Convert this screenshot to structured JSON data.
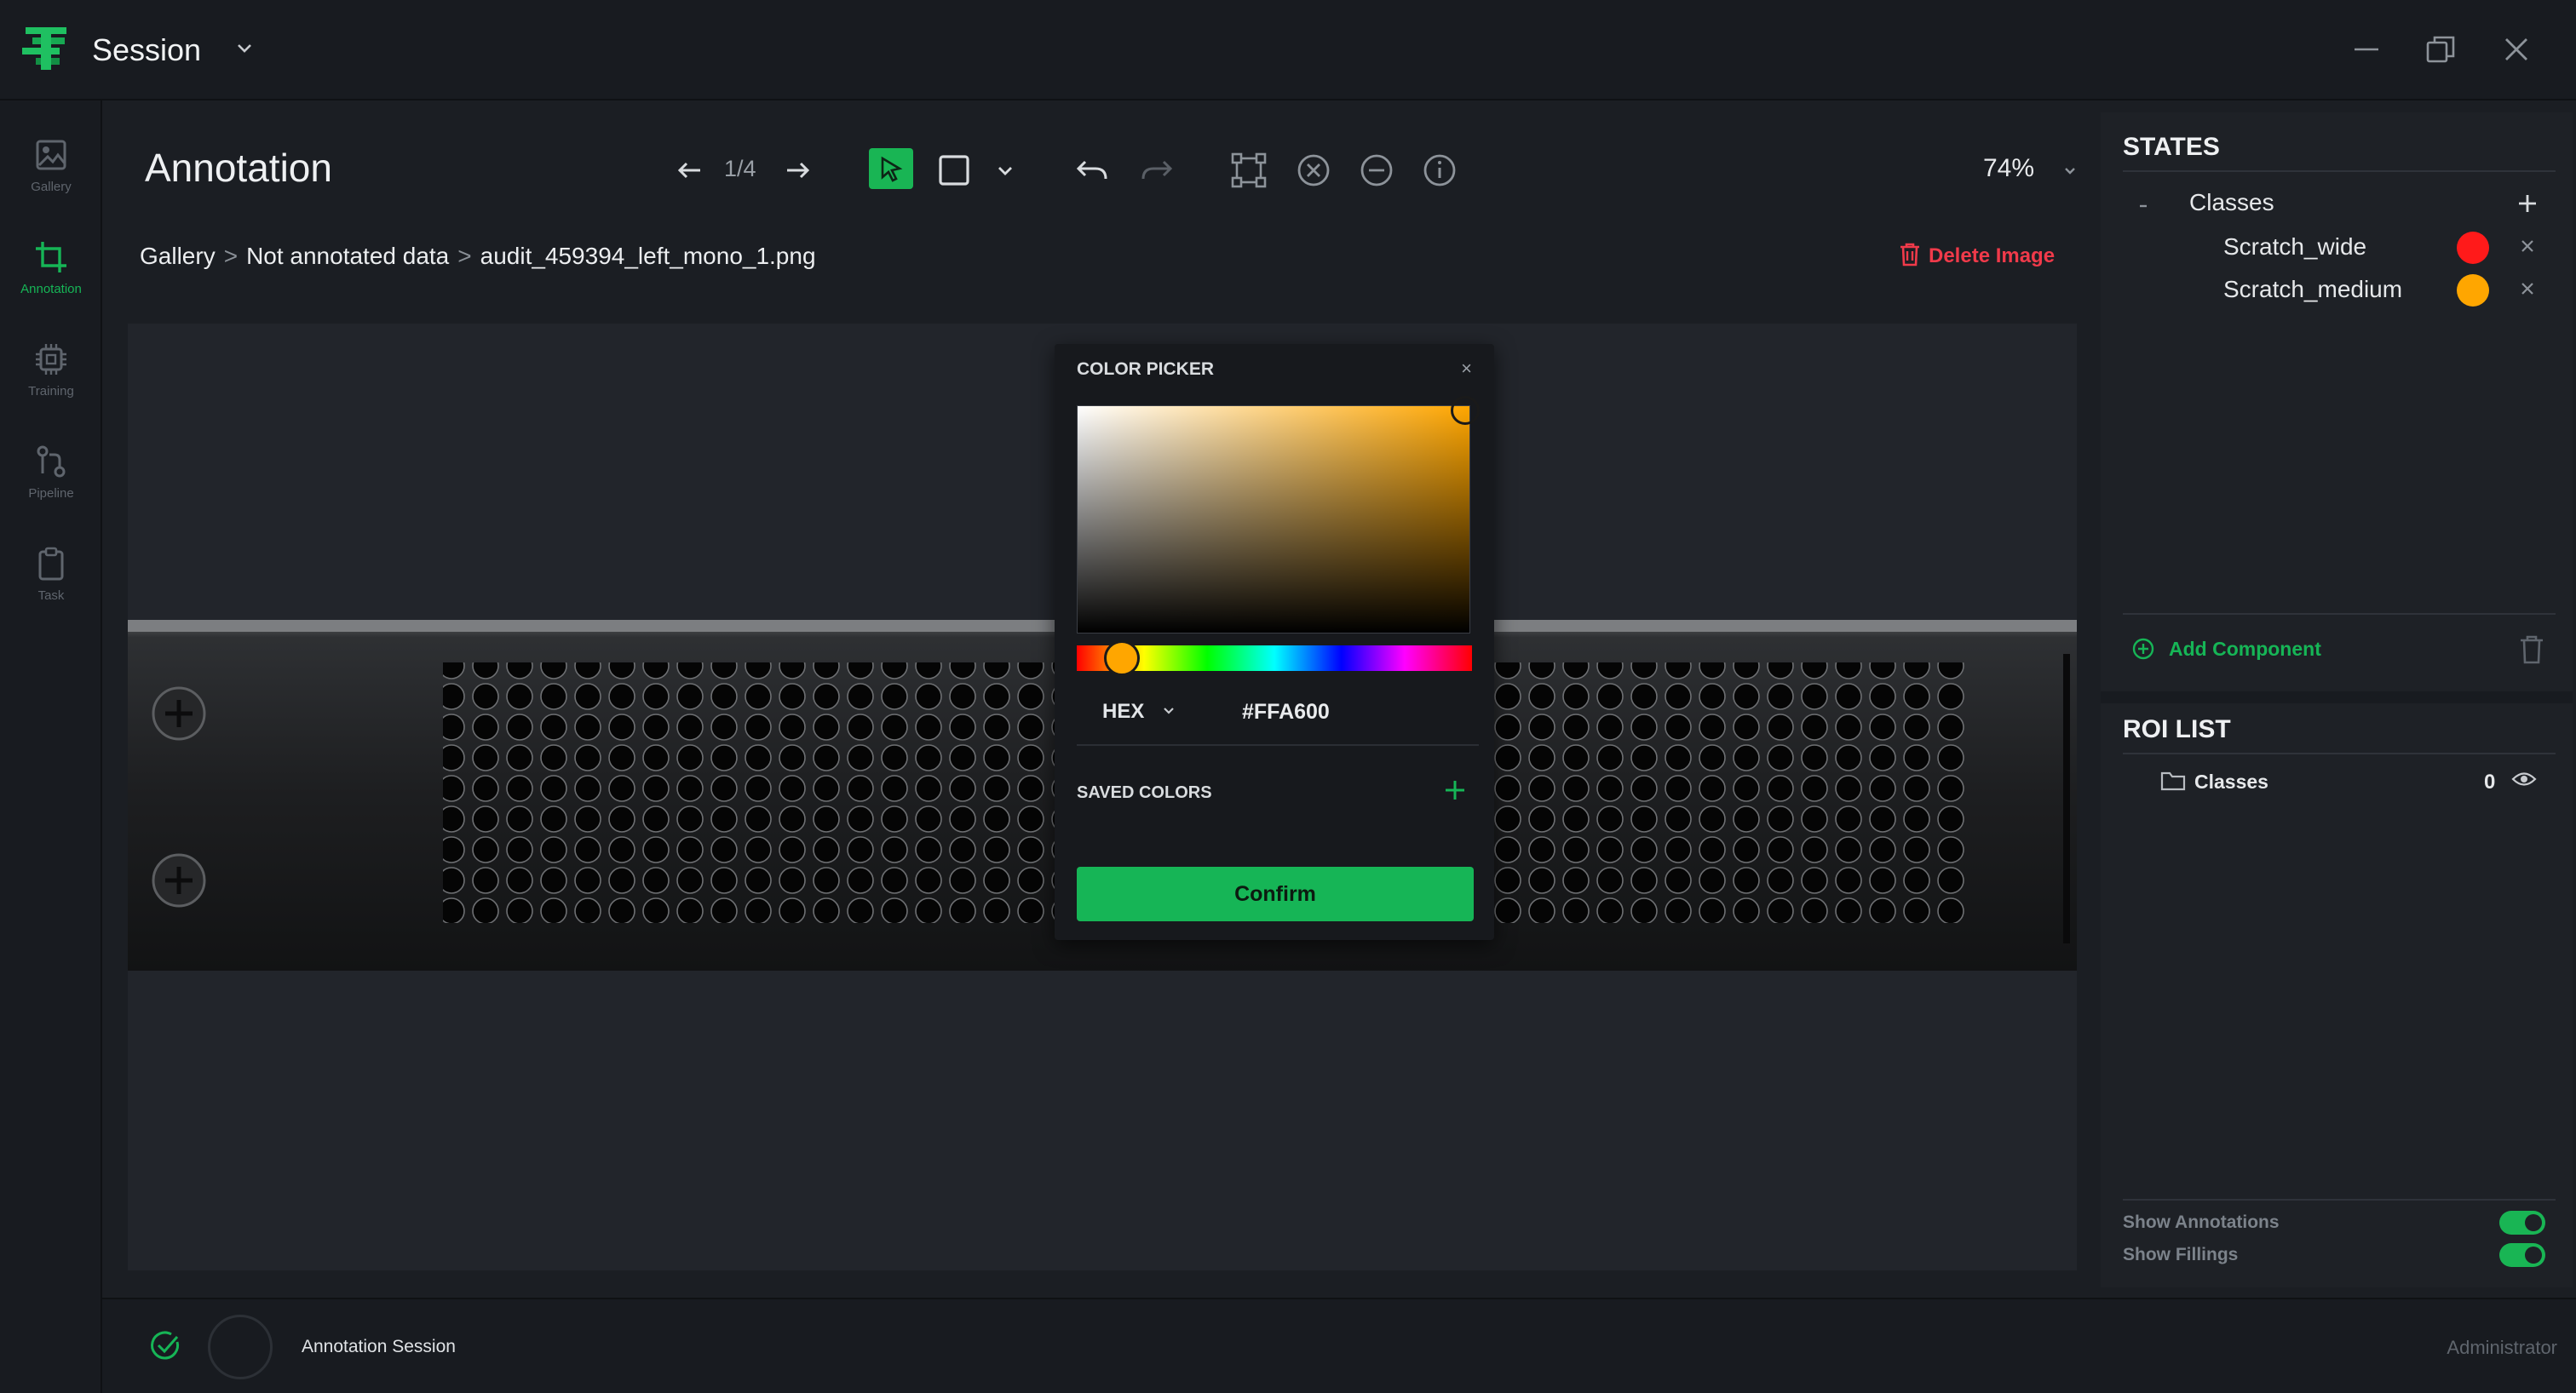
{
  "app": {
    "title": "Session"
  },
  "sidebar": {
    "items": [
      {
        "label": "Gallery",
        "icon": "image-icon"
      },
      {
        "label": "Annotation",
        "icon": "crop-icon",
        "active": true
      },
      {
        "label": "Training",
        "icon": "chip-icon"
      },
      {
        "label": "Pipeline",
        "icon": "pipeline-icon"
      },
      {
        "label": "Task",
        "icon": "clipboard-icon"
      }
    ]
  },
  "header": {
    "title": "Annotation",
    "page_counter": "1/4",
    "zoom": "74%"
  },
  "breadcrumb": {
    "items": [
      "Gallery",
      "Not annotated data",
      "audit_459394_left_mono_1.png"
    ],
    "separator": ">"
  },
  "delete_image_label": "Delete Image",
  "color_picker": {
    "title": "COLOR PICKER",
    "close": "×",
    "mode": "HEX",
    "value": "#FFA600",
    "saved_colors_label": "SAVED COLORS",
    "confirm_label": "Confirm"
  },
  "states": {
    "title": "STATES",
    "group_label": "Classes",
    "classes": [
      {
        "name": "Scratch_wide",
        "color": "#ff1a1a"
      },
      {
        "name": "Scratch_medium",
        "color": "#ffa600"
      }
    ],
    "add_component_label": "Add Component"
  },
  "roi_list": {
    "title": "ROI LIST",
    "group_label": "Classes",
    "count": "0"
  },
  "toggles": {
    "show_annotations": "Show Annotations",
    "show_fillings": "Show Fillings"
  },
  "status": {
    "session_label": "Annotation Session",
    "user_role": "Administrator"
  },
  "colors": {
    "accent": "#16b556",
    "danger": "#f03a4a",
    "background": "#1b1e23"
  }
}
